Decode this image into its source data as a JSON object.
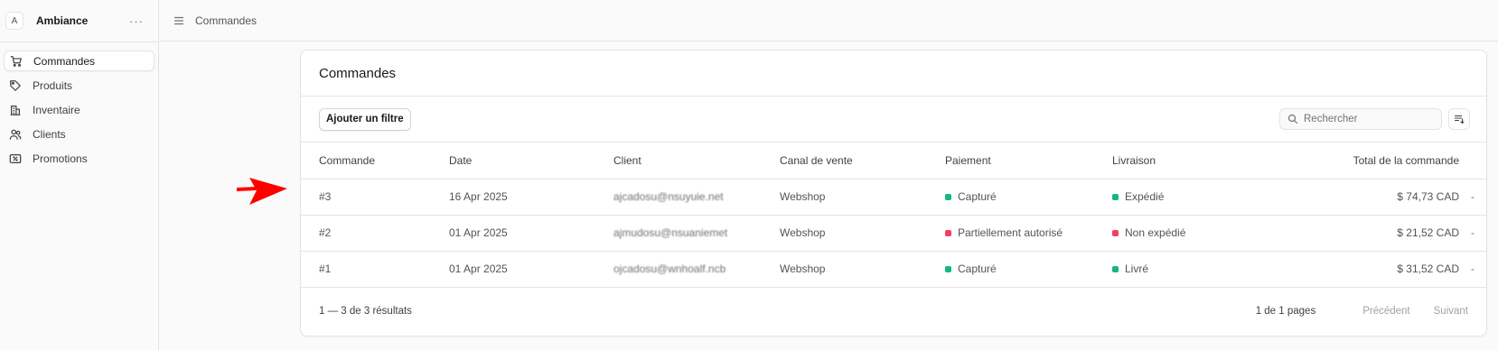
{
  "sidebar": {
    "store_initial": "A",
    "store_name": "Ambiance",
    "more": "···",
    "items": [
      {
        "label": "Commandes",
        "icon": "cart-icon",
        "active": true
      },
      {
        "label": "Produits",
        "icon": "tag-icon"
      },
      {
        "label": "Inventaire",
        "icon": "building-icon"
      },
      {
        "label": "Clients",
        "icon": "users-icon"
      },
      {
        "label": "Promotions",
        "icon": "receipt-percent-icon"
      }
    ]
  },
  "topbar": {
    "breadcrumb": "Commandes",
    "icon": "sidebar-toggle-icon"
  },
  "main": {
    "title": "Commandes",
    "filter_button": "Ajouter un filtre",
    "search_placeholder": "Rechercher",
    "columns": [
      "Commande",
      "Date",
      "Client",
      "Canal de vente",
      "Paiement",
      "Livraison",
      "Total de la commande"
    ],
    "rows": [
      {
        "id": "#3",
        "date": "16 Apr 2025",
        "client": "ajcadosu@nsuyuie.net",
        "channel": "Webshop",
        "payment": "Capturé",
        "payment_color": "#10b981",
        "delivery": "Expédié",
        "delivery_color": "#10b981",
        "total": "$ 74,73 CAD",
        "action": "-"
      },
      {
        "id": "#2",
        "date": "01 Apr 2025",
        "client": "ajmudosu@nsuaniemet",
        "channel": "Webshop",
        "payment": "Partiellement autorisé",
        "payment_color": "#f43f5e",
        "delivery": "Non expédié",
        "delivery_color": "#f43f5e",
        "total": "$ 21,52 CAD",
        "action": "-"
      },
      {
        "id": "#1",
        "date": "01 Apr 2025",
        "client": "ojcadosu@wnhoalf.ncb",
        "channel": "Webshop",
        "payment": "Capturé",
        "payment_color": "#10b981",
        "delivery": "Livré",
        "delivery_color": "#10b981",
        "total": "$ 31,52 CAD",
        "action": "-"
      }
    ],
    "footer": {
      "results": "1 — 3 de 3 résultats",
      "pages": "1 de 1 pages",
      "prev": "Précédent",
      "next": "Suivant"
    }
  },
  "annotation": {
    "color": "#ff0000"
  }
}
